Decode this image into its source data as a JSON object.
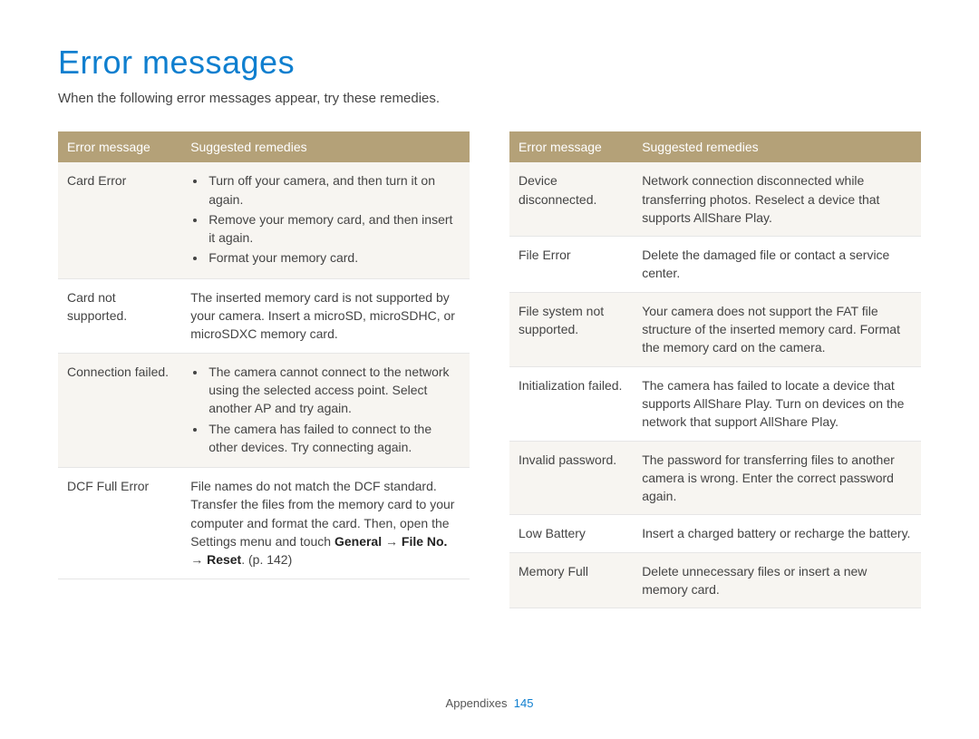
{
  "title": "Error messages",
  "intro": "When the following error messages appear, try these remedies.",
  "headers": {
    "col1": "Error message",
    "col2": "Suggested remedies"
  },
  "left": [
    {
      "msg": "Card Error",
      "type": "list",
      "items": [
        "Turn off your camera, and then turn it on again.",
        "Remove your memory card, and then insert it again.",
        "Format your memory card."
      ],
      "alt": true
    },
    {
      "msg": "Card not supported.",
      "type": "text",
      "text": "The inserted memory card is not supported by your camera. Insert a microSD, microSDHC, or microSDXC memory card.",
      "alt": false
    },
    {
      "msg": "Connection failed.",
      "type": "list",
      "items": [
        "The camera cannot connect to the network using the selected access point. Select another AP and try again.",
        "The camera has failed to connect to the other devices. Try connecting again."
      ],
      "alt": true
    },
    {
      "msg": "DCF Full Error",
      "type": "rich",
      "pre": "File names do not match the DCF standard. Transfer the files from the memory card to your computer and format the card. Then, open the Settings menu and touch ",
      "bold1": "General",
      "mid": " → ",
      "bold2": "File No.",
      "mid2": " → ",
      "bold3": "Reset",
      "post": ". (p. 142)",
      "alt": false
    }
  ],
  "right": [
    {
      "msg": "Device disconnected.",
      "type": "text",
      "text": "Network connection disconnected while transferring photos. Reselect a device that supports AllShare Play.",
      "alt": true
    },
    {
      "msg": "File Error",
      "type": "text",
      "text": "Delete the damaged file or contact a service center.",
      "alt": false
    },
    {
      "msg": "File system not supported.",
      "type": "text",
      "text": "Your camera does not support the FAT file structure of the inserted memory card. Format the memory card on the camera.",
      "alt": true
    },
    {
      "msg": "Initialization failed.",
      "type": "text",
      "text": "The camera has failed to locate a device that supports AllShare Play. Turn on devices on the network that support AllShare Play.",
      "alt": false
    },
    {
      "msg": "Invalid password.",
      "type": "text",
      "text": "The password for transferring files to another camera is wrong. Enter the correct password again.",
      "alt": true
    },
    {
      "msg": "Low Battery",
      "type": "text",
      "text": "Insert a charged battery or recharge the battery.",
      "alt": false
    },
    {
      "msg": "Memory Full",
      "type": "text",
      "text": "Delete unnecessary files or insert a new memory card.",
      "alt": true
    }
  ],
  "footer": {
    "section": "Appendixes",
    "page": "145"
  }
}
